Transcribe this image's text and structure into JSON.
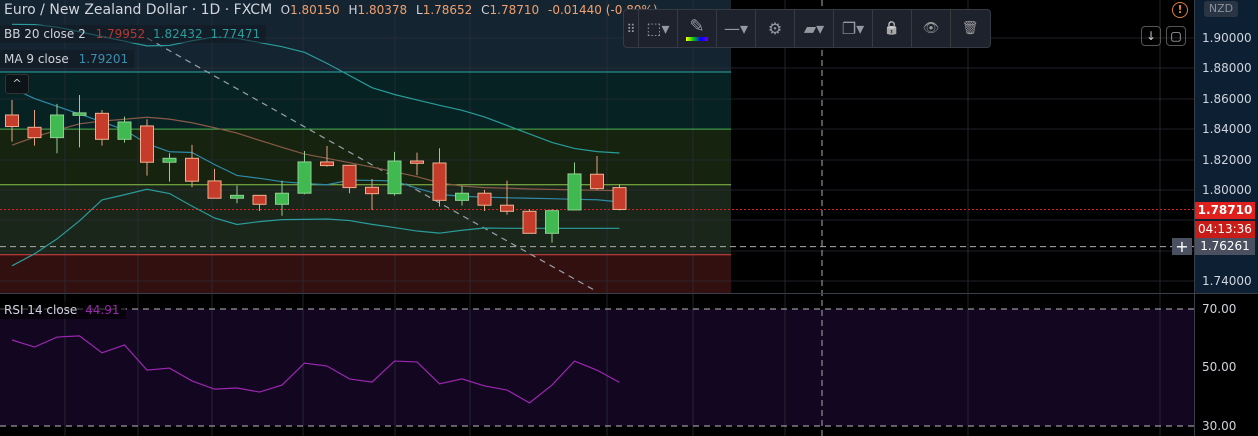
{
  "header": {
    "symbol": "Euro / New Zealand Dollar",
    "interval": "1D",
    "exchange": "FXCM",
    "separator": "·",
    "open_label": "O",
    "open": "1.80150",
    "high_label": "H",
    "high": "1.80378",
    "low_label": "L",
    "low": "1.78652",
    "close_label": "C",
    "close": "1.78710",
    "change": "-0.01440 (-0.80%)"
  },
  "indicators": {
    "bb": {
      "label": "BB 20 close 2",
      "basis": "1.79952",
      "upper": "1.82432",
      "lower": "1.77471"
    },
    "ma": {
      "label": "MA 9 close",
      "value": "1.79201"
    },
    "rsi": {
      "label": "RSI 14 close",
      "value": "44.91"
    },
    "collapse": "^"
  },
  "toolbar": {
    "drag": "⠿",
    "select": "⬚▾",
    "pencil": "✎",
    "line_style": "—▾",
    "settings": "⚙",
    "layers": "▰▾",
    "clone": "❐▾",
    "lock": "🔒",
    "visibility": "👁",
    "delete": "🗑"
  },
  "price_axis": {
    "currency": "NZD",
    "ticks": [
      "1.90000",
      "1.88000",
      "1.86000",
      "1.84000",
      "1.82000",
      "1.80000",
      "1.74000"
    ],
    "last_price": "1.78710",
    "countdown": "04:13:36",
    "crosshair_price": "1.76261",
    "rsi_ticks": [
      "70.00",
      "50.00",
      "30.00"
    ],
    "warning": "!",
    "scroll_down": "↓",
    "auto_scale": "▢",
    "crosshair_add": "+"
  },
  "colors": {
    "up": "#3fb950",
    "down": "#c63c2a",
    "band": "#2a9c9c",
    "basis": "#8a5a48",
    "rsi": "#9c27b0",
    "last": "#e0201c"
  },
  "chart_data": {
    "type": "candlestick",
    "title": "Euro / New Zealand Dollar · 1D · FXCM",
    "ylim": [
      1.73,
      1.915
    ],
    "ohlc": [
      [
        1.8493,
        1.8592,
        1.8318,
        1.8417
      ],
      [
        1.8412,
        1.8526,
        1.8291,
        1.8344
      ],
      [
        1.8344,
        1.8566,
        1.8241,
        1.8493
      ],
      [
        1.8491,
        1.8625,
        1.828,
        1.8507
      ],
      [
        1.8504,
        1.8526,
        1.8291,
        1.8333
      ],
      [
        1.8333,
        1.8482,
        1.8311,
        1.8447
      ],
      [
        1.8421,
        1.8465,
        1.8094,
        1.8182
      ],
      [
        1.8182,
        1.8241,
        1.8054,
        1.8208
      ],
      [
        1.8208,
        1.8296,
        1.8017,
        1.8057
      ],
      [
        1.8059,
        1.8138,
        1.7945,
        1.7945
      ],
      [
        1.7945,
        1.8028,
        1.7912,
        1.7964
      ],
      [
        1.7964,
        1.7964,
        1.7861,
        1.7905
      ],
      [
        1.7905,
        1.8061,
        1.783,
        1.7978
      ],
      [
        1.7978,
        1.8256,
        1.7971,
        1.8184
      ],
      [
        1.8184,
        1.8289,
        1.8153,
        1.816
      ],
      [
        1.8162,
        1.8162,
        1.7978,
        1.8015
      ],
      [
        1.8017,
        1.8072,
        1.7868,
        1.7975
      ],
      [
        1.7975,
        1.825,
        1.7962,
        1.819
      ],
      [
        1.819,
        1.8245,
        1.8096,
        1.8175
      ],
      [
        1.8177,
        1.8274,
        1.789,
        1.7931
      ],
      [
        1.7931,
        1.8026,
        1.7896,
        1.7978
      ],
      [
        1.7978,
        1.8,
        1.7861,
        1.7899
      ],
      [
        1.7899,
        1.8061,
        1.7837,
        1.7859
      ],
      [
        1.7859,
        1.7872,
        1.7714,
        1.7714
      ],
      [
        1.7714,
        1.7872,
        1.7653,
        1.7863
      ],
      [
        1.7868,
        1.818,
        1.7868,
        1.8105
      ],
      [
        1.8103,
        1.8223,
        1.8,
        1.8008
      ],
      [
        1.8015,
        1.80378,
        1.78652,
        1.7871
      ]
    ],
    "bb_upper": [
      1.909,
      1.9088,
      1.9072,
      1.9041,
      1.901,
      1.8979,
      1.8948,
      1.8951,
      1.8982,
      1.9007,
      1.8998,
      1.897,
      1.8943,
      1.8906,
      1.8833,
      1.8753,
      1.8673,
      1.8628,
      1.8592,
      1.8557,
      1.8524,
      1.848,
      1.8424,
      1.8368,
      1.8312,
      1.8273,
      1.8252,
      1.8243
    ],
    "bb_basis": [
      1.8294,
      1.8348,
      1.8393,
      1.8435,
      1.8453,
      1.8465,
      1.8478,
      1.8466,
      1.8442,
      1.8409,
      1.8374,
      1.8326,
      1.828,
      1.8236,
      1.8208,
      1.8179,
      1.815,
      1.8119,
      1.8087,
      1.8046,
      1.8025,
      1.8015,
      1.8011,
      1.8006,
      1.8003,
      1.8,
      1.7997,
      1.7995
    ],
    "bb_lower": [
      1.75,
      1.7579,
      1.7677,
      1.7796,
      1.7934,
      1.7968,
      1.8004,
      1.7976,
      1.7893,
      1.7815,
      1.7772,
      1.7791,
      1.7804,
      1.7806,
      1.7808,
      1.7798,
      1.7773,
      1.7752,
      1.7729,
      1.7715,
      1.7734,
      1.7749,
      1.7747,
      1.7747,
      1.7747,
      1.7747,
      1.7747,
      1.7747
    ],
    "ma9": [
      1.867,
      1.8601,
      1.855,
      1.8499,
      1.8448,
      1.8395,
      1.8304,
      1.8251,
      1.8246,
      1.8167,
      1.8095,
      1.8076,
      1.8054,
      1.8042,
      1.8034,
      1.8064,
      1.8062,
      1.8059,
      1.801,
      1.797,
      1.7958,
      1.7952,
      1.7948,
      1.7945,
      1.7942,
      1.7938,
      1.7935,
      1.7921
    ],
    "rsi": [
      59.4,
      57.0,
      60.4,
      60.8,
      55.0,
      57.7,
      49.1,
      49.8,
      45.4,
      42.6,
      43.0,
      41.6,
      44.0,
      51.5,
      50.5,
      46.1,
      45.0,
      52.2,
      51.9,
      44.4,
      46.1,
      43.7,
      42.3,
      37.9,
      44.0,
      52.2,
      49.1,
      44.91
    ],
    "rsi_levels": [
      70,
      50,
      30
    ],
    "rsi_ylim": [
      30,
      70
    ],
    "horizontal_levels": [
      1.8776,
      1.84,
      1.8034,
      1.7626,
      1.7573
    ],
    "trendline": {
      "from": [
        1.9,
        6
      ],
      "to": [
        1.733,
        26
      ]
    }
  }
}
